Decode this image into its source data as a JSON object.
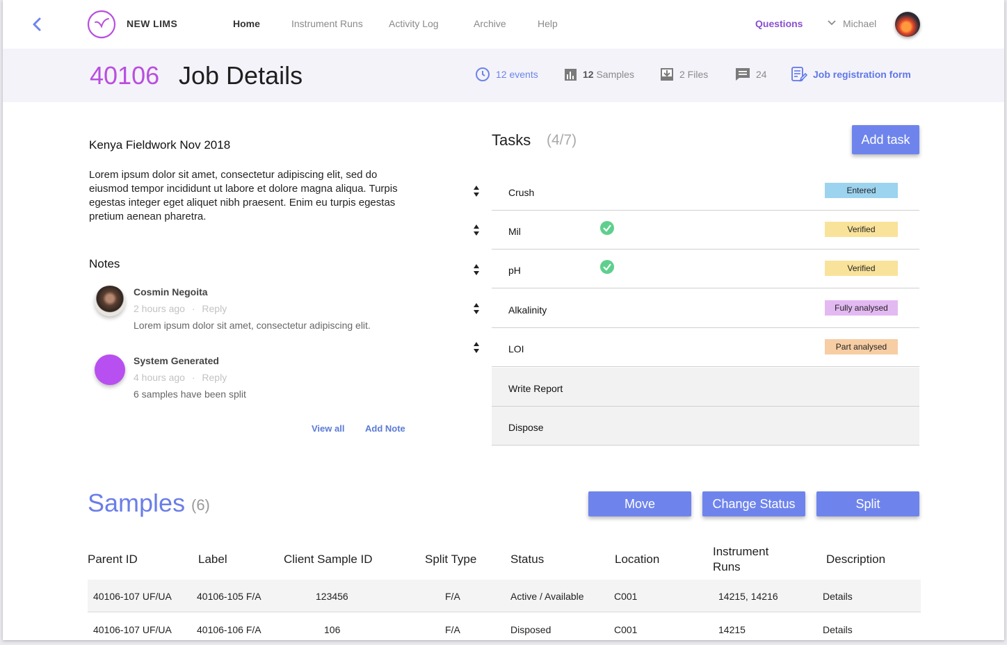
{
  "nav": {
    "brand": "NEW LIMS",
    "items": [
      "Home",
      "Instrument Runs",
      "Activity Log",
      "Archive",
      "Help"
    ],
    "questions": "Questions",
    "user": "Michael"
  },
  "header": {
    "job_id": "40106",
    "title": "Job Details",
    "events": "12 events",
    "samples_count": "12",
    "samples_label": "Samples",
    "files": "2 Files",
    "comments": "24",
    "registration_form": "Job registration form"
  },
  "project": {
    "title": "Kenya Fieldwork Nov 2018",
    "description": "Lorem ipsum dolor sit amet, consectetur adipiscing elit, sed do eiusmod tempor incididunt ut labore et dolore magna aliqua. Turpis egestas integer eget aliquet nibh praesent. Enim eu turpis egestas pretium aenean pharetra."
  },
  "notes": {
    "heading": "Notes",
    "items": [
      {
        "author": "Cosmin Negoita",
        "time": "2 hours ago",
        "reply": "Reply",
        "text": "Lorem ipsum dolor sit amet, consectetur adipiscing elit."
      },
      {
        "author": "System Generated",
        "time": "4 hours ago",
        "reply": "Reply",
        "text": "6 samples have been split"
      }
    ],
    "view_all": "View all",
    "add_note": "Add Note",
    "separator": "·"
  },
  "tasks": {
    "heading": "Tasks",
    "count": "(4/7)",
    "add_task": "Add task",
    "items": [
      {
        "name": "Crush",
        "status": "Entered",
        "status_color": "#9cd3ef",
        "verified": false
      },
      {
        "name": "Mil",
        "status": "Verified",
        "status_color": "#f9e29a",
        "verified": true
      },
      {
        "name": "pH",
        "status": "Verified",
        "status_color": "#f9e29a",
        "verified": true
      },
      {
        "name": "Alkalinity",
        "status": "Fully analysed",
        "status_color": "#e3b9f2",
        "verified": false
      },
      {
        "name": "LOI",
        "status": "Part analysed",
        "status_color": "#f7cda4",
        "verified": false
      },
      {
        "name": "Write Report",
        "status": "",
        "verified": false
      },
      {
        "name": "Dispose",
        "status": "",
        "verified": false
      }
    ]
  },
  "samples": {
    "heading": "Samples",
    "count": "(6)",
    "buttons": {
      "move": "Move",
      "change_status": "Change Status",
      "split": "Split"
    },
    "columns": [
      "Parent ID",
      "Label",
      "Client Sample ID",
      "Split Type",
      "Status",
      "Location",
      "Instrument Runs",
      "Description"
    ],
    "rows": [
      [
        "40106-107 UF/UA",
        "40106-105 F/A",
        "123456",
        "F/A",
        "Active / Available",
        "C001",
        "14215, 14216",
        "Details"
      ],
      [
        "40106-107 UF/UA",
        "40106-106 F/A",
        "106",
        "F/A",
        "Disposed",
        "C001",
        "14215",
        "Details"
      ]
    ]
  },
  "colors": {
    "accent": "#6e84ec",
    "job_id": "#b84fe0",
    "questions": "#8a4fd0",
    "check": "#5fcf8e"
  },
  "icons": [
    "back-icon",
    "logo-icon",
    "chevron-down-icon",
    "clock-icon",
    "bar-chart-icon",
    "download-box-icon",
    "comment-icon",
    "form-edit-icon",
    "drag-handle-icon",
    "check-circle-icon"
  ]
}
